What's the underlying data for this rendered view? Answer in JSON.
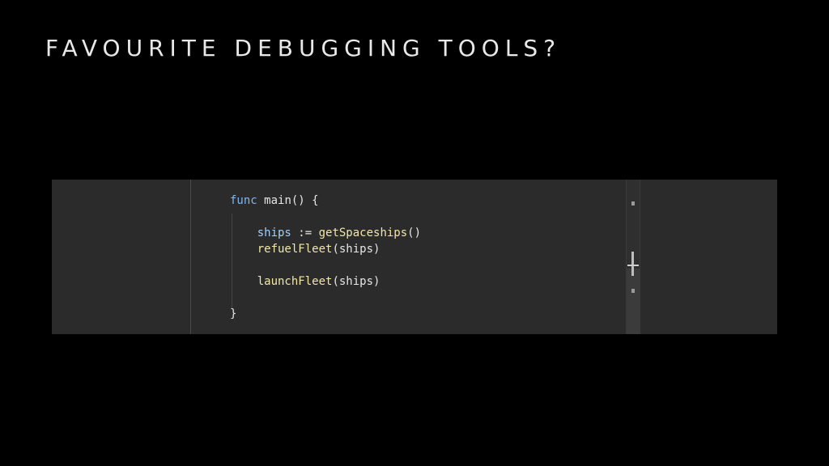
{
  "slide": {
    "title": "FAVOURITE DEBUGGING TOOLS?"
  },
  "editor": {
    "code_lines": [
      {
        "parts": [
          {
            "t": "func",
            "k": "kw"
          },
          {
            "t": " ",
            "k": "plain"
          },
          {
            "t": "main",
            "k": "fn-def"
          },
          {
            "t": "() {",
            "k": "plain"
          }
        ]
      },
      {
        "parts": []
      },
      {
        "parts": [
          {
            "t": "    ",
            "k": "plain"
          },
          {
            "t": "ships",
            "k": "var"
          },
          {
            "t": " := ",
            "k": "plain"
          },
          {
            "t": "getSpaceships",
            "k": "fn"
          },
          {
            "t": "()",
            "k": "plain"
          }
        ]
      },
      {
        "parts": [
          {
            "t": "    ",
            "k": "plain"
          },
          {
            "t": "refuelFleet",
            "k": "fn"
          },
          {
            "t": "(ships)",
            "k": "plain"
          }
        ]
      },
      {
        "parts": []
      },
      {
        "parts": [
          {
            "t": "    ",
            "k": "plain"
          },
          {
            "t": "launchFleet",
            "k": "fn"
          },
          {
            "t": "(ships)",
            "k": "plain"
          }
        ]
      },
      {
        "parts": []
      },
      {
        "parts": [
          {
            "t": "}",
            "k": "plain"
          }
        ]
      }
    ]
  }
}
